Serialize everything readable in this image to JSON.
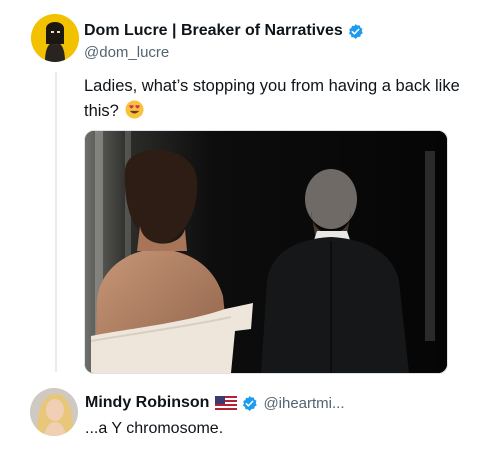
{
  "main_tweet": {
    "author_name": "Dom Lucre | Breaker of Narratives",
    "author_handle": "@dom_lucre",
    "verified": true,
    "text": "Ladies, what’s stopping you from having a back like this?",
    "emoji": "heart-eyes-emoji"
  },
  "reply_tweet": {
    "author_name": "Mindy Robinson",
    "flag": "us-flag-icon",
    "verified": true,
    "author_handle": "@iheartmi...",
    "text": "...a Y chromosome."
  },
  "colors": {
    "verified_blue": "#1d9bf0",
    "handle_gray": "#536471",
    "text_dark": "#0f1419",
    "avatar_yellow": "#f2c200"
  }
}
